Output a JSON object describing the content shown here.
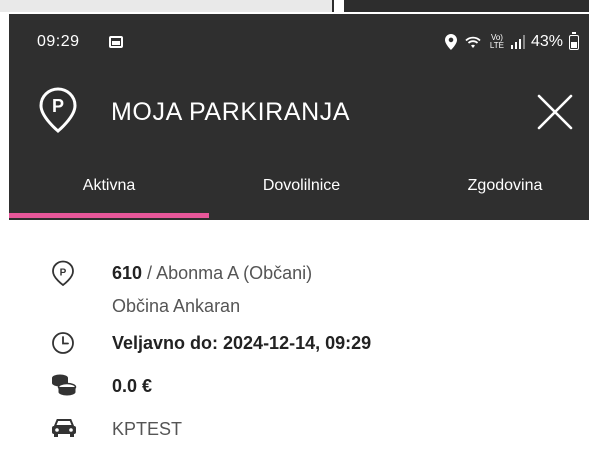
{
  "status_bar": {
    "time": "09:29",
    "battery_percent": "43%",
    "network_label": "Vo) LTE"
  },
  "header": {
    "title": "MOJA PARKIRANJA"
  },
  "tabs": [
    {
      "label": "Aktivna",
      "active": true
    },
    {
      "label": "Dovolilnice",
      "active": false
    },
    {
      "label": "Zgodovina",
      "active": false
    }
  ],
  "parking": {
    "id": "610",
    "separator": " / ",
    "subscription": "Abonma A (Občani)",
    "municipality": "Občina Ankaran",
    "valid_until": "Veljavno do: 2024-12-14, 09:29",
    "price": "0.0 €",
    "plate": "KPTEST"
  },
  "colors": {
    "header_bg": "#2f2f2f",
    "accent": "#e8579a",
    "text": "#222222"
  },
  "icons": {
    "logo": "parking-pin-icon",
    "close": "close-icon",
    "zone": "parking-pin-icon",
    "clock": "clock-icon",
    "coins": "coins-icon",
    "car": "car-icon"
  }
}
